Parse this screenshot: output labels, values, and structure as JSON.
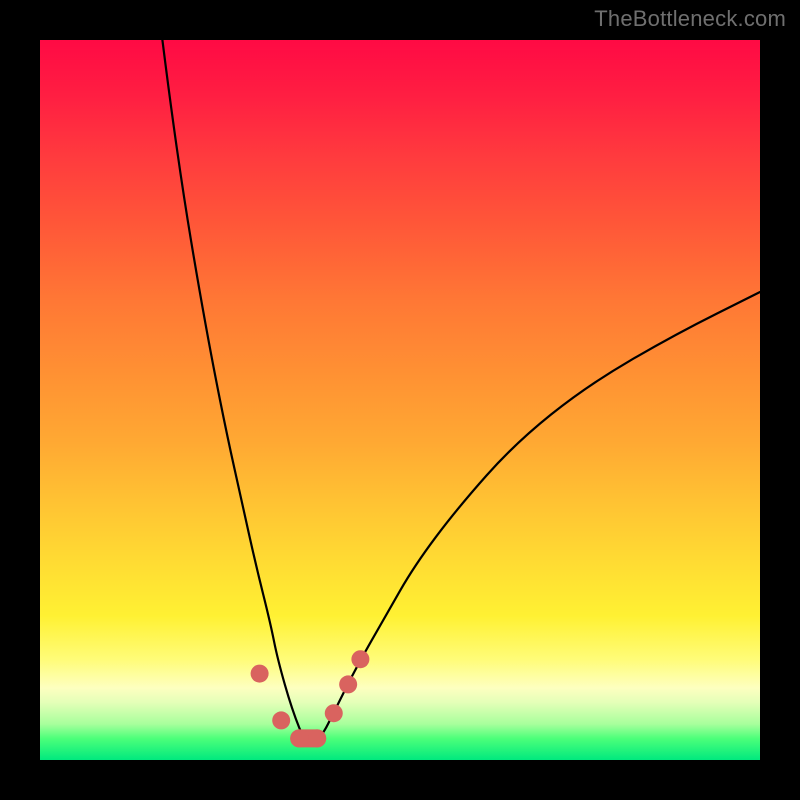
{
  "watermark": "TheBottleneck.com",
  "colors": {
    "background": "#000000",
    "curve": "#000000",
    "marker": "#d9635f"
  },
  "chart_data": {
    "type": "line",
    "title": "",
    "xlabel": "",
    "ylabel": "",
    "xlim": [
      0,
      100
    ],
    "ylim": [
      0,
      100
    ],
    "note": "Axis values are percentages of the plot area. y = 0 is bottom (best / green), y = 100 is top (worst / red). The curve is a V-shaped bottleneck profile with its minimum near x ≈ 37.",
    "series": [
      {
        "name": "bottleneck-curve",
        "x": [
          17,
          18,
          20,
          22,
          24,
          26,
          28,
          30,
          32,
          33,
          35,
          37,
          39,
          41,
          44,
          48,
          52,
          58,
          66,
          76,
          88,
          100
        ],
        "y": [
          100,
          92,
          78,
          66,
          55,
          45,
          36,
          27,
          19,
          14,
          7,
          2,
          3,
          7,
          13,
          20,
          27,
          35,
          44,
          52,
          59,
          65
        ]
      }
    ],
    "markers": {
      "name": "highlighted-points",
      "x": [
        30.5,
        33.5,
        36.0,
        38.5,
        40.8,
        42.8,
        44.5
      ],
      "y": [
        12.0,
        5.5,
        3.0,
        3.0,
        6.5,
        10.5,
        14.0
      ]
    },
    "gradient_stops": [
      {
        "pct": 0,
        "color": "#ff0a44"
      },
      {
        "pct": 50,
        "color": "#ff9933"
      },
      {
        "pct": 80,
        "color": "#fff233"
      },
      {
        "pct": 100,
        "color": "#00e97e"
      }
    ]
  }
}
